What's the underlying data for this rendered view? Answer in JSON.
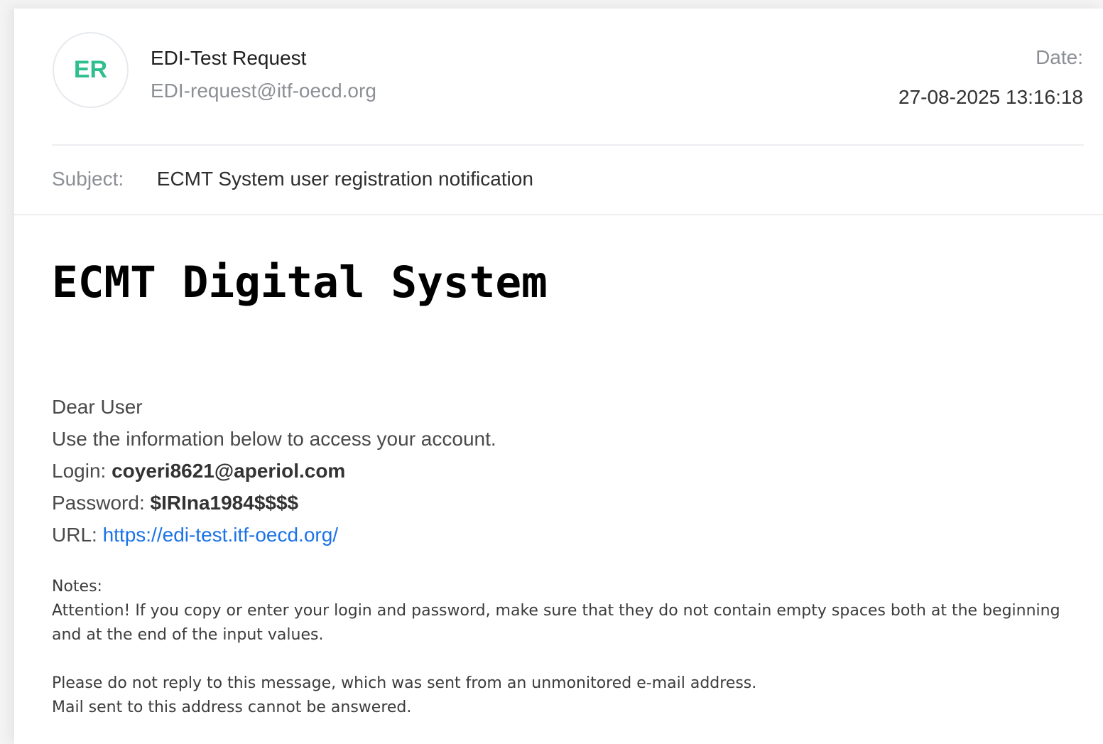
{
  "sender": {
    "initials": "ER",
    "name": "EDI-Test Request",
    "email": "EDI-request@itf-oecd.org"
  },
  "date": {
    "label": "Date:",
    "value": "27-08-2025 13:16:18"
  },
  "subject": {
    "label": "Subject:",
    "value": "ECMT System user registration notification"
  },
  "body": {
    "title": "ECMT Digital System",
    "greeting": "Dear User",
    "intro": "Use the information below to access your account.",
    "login_label": "Login:",
    "login_value": "coyeri8621@aperiol.com",
    "password_label": "Password:",
    "password_value": "$IRIna1984$$$$",
    "url_label": "URL:",
    "url_value": "https://edi-test.itf-oecd.org/"
  },
  "notes": {
    "heading": "Notes:",
    "attention": "Attention! If you copy or enter your login and password, make sure that they do not contain empty spaces both at the beginning and at the end of the input values.",
    "line1": "Please do not reply to this message, which was sent from an unmonitored e-mail address.",
    "line2": "Mail sent to this address cannot be answered."
  },
  "colors": {
    "avatar_text": "#2fbf8f",
    "link": "#1a73e8",
    "muted": "#8c8f94"
  }
}
